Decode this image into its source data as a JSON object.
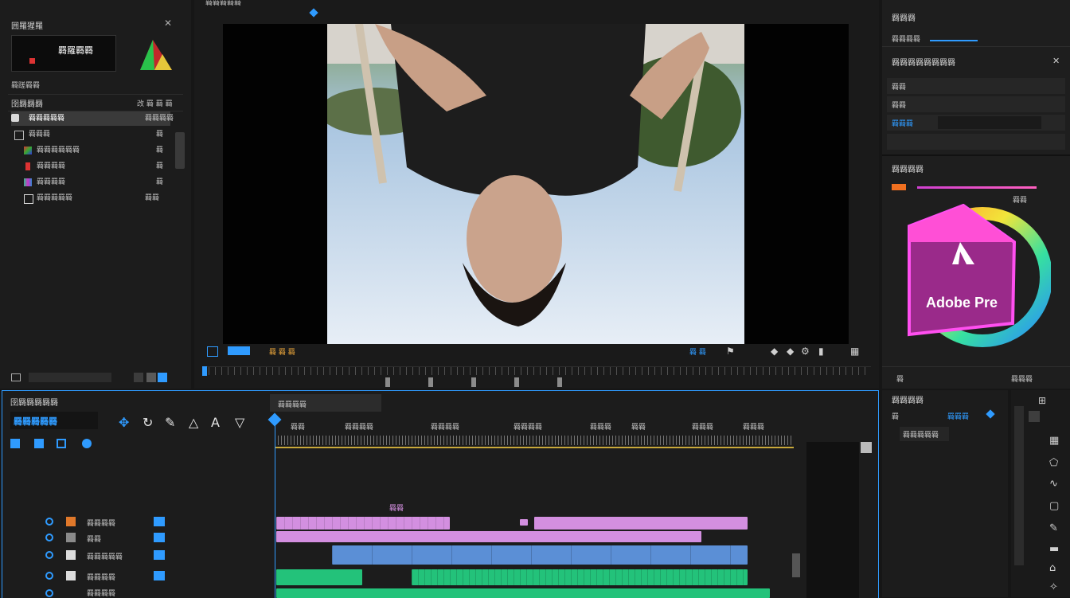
{
  "project": {
    "title": "囲羅猩羅",
    "thumb_title": "羇羅羇羇",
    "meta": "羇蹉羇羇",
    "list_header": "囹羇羇羇",
    "list_header_right": "改 羇 羇 羇",
    "items": [
      {
        "label": "羇羇羇羇羇",
        "right": "羇羇羇羇"
      },
      {
        "label": "羇羇羇",
        "right": "羇"
      },
      {
        "label": "羇羇羇羇羇羇",
        "right": "羇"
      },
      {
        "label": "羇羇羇羇",
        "right": "羇"
      },
      {
        "label": "羇羇羇羇",
        "right": "羇"
      },
      {
        "label": "羇羇羇羇羇",
        "right": "羇羇"
      }
    ]
  },
  "monitor": {
    "tab": "羇羇羇羇羇",
    "controls_left": "羇 羇 羇",
    "controls_right": "羇 羇"
  },
  "effects": {
    "title": "羇羇羇",
    "field_label": "羇羇羇羇",
    "section_title": "羇羇羇羇羇羇羇羇",
    "rows": [
      "羇羇",
      "羇羇",
      "羇羇羇"
    ],
    "color_title": "羇羇羇羇",
    "color_value": "羇羇",
    "footer_left": "羇",
    "footer_right": "羇羇羇"
  },
  "logo": {
    "text": "Adobe Pre"
  },
  "timeline": {
    "title": "囹羇羇羇羇羇",
    "timecode": "羇羇羇羇羇",
    "tab": "羇羇羇羇",
    "marker": "羇羇",
    "track_labels": [
      "羇羇羇羇",
      "羇羇",
      "羇羇羇羇羇",
      "羇羇羇羇",
      "羇羇羇羇"
    ],
    "ruler_labels": [
      "羇羇",
      "羇羇羇羇",
      "羇羇羇羇",
      "羇羇羇羇",
      "羇羇羇",
      "羇羇",
      "羇羇羇",
      "羇羇羇"
    ]
  },
  "right_lower": {
    "title": "羇羇羇羇",
    "row1_left": "羇",
    "row1_right": "羇羇羇",
    "button": "羇羇羇羇羇"
  },
  "colors": {
    "accent_blue": "#2f9bff",
    "clip_pink": "#d38fe0",
    "clip_blue": "#5b8fd6",
    "clip_green": "#23c27a",
    "playhead": "#2f9bff"
  }
}
